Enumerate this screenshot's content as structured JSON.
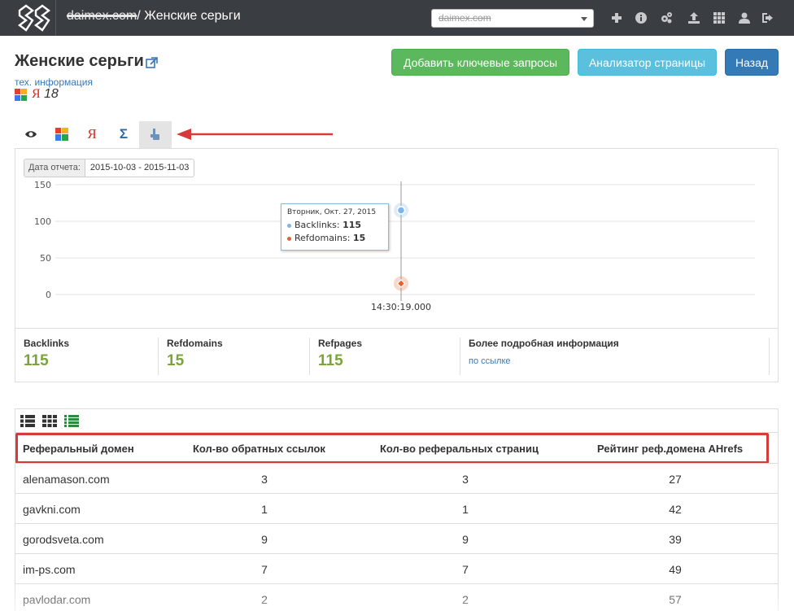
{
  "navbar": {
    "domain": "daimex.com",
    "separator": "/",
    "page": "Женские серьги",
    "site_select_value": "daimex.com",
    "icons": [
      "plus-icon",
      "info-icon",
      "cogs-icon",
      "upload-icon",
      "grid-icon",
      "user-icon",
      "logout-icon"
    ]
  },
  "header": {
    "title": "Женские серьги",
    "tech_link": "тех. информация",
    "yandex_letter": "Я",
    "position": "18"
  },
  "buttons": {
    "add_keywords": "Добавить ключевые запросы",
    "page_analyzer": "Анализатор страницы",
    "back": "Назад"
  },
  "tabs": {
    "yandex_letter": "Я",
    "sum_letter": "Σ",
    "active": "cursor-hand"
  },
  "report": {
    "date_label": "Дата отчета:",
    "date_range": "2015-10-03 - 2015-11-03"
  },
  "colors": {
    "backlinks": "#7cb5ec",
    "refdomains": "#e4632a",
    "stat_value": "#7aa33b",
    "highlight_box": "#d63a3a"
  },
  "chart_data": {
    "type": "scatter",
    "ylim": [
      0,
      150
    ],
    "y_ticks": [
      "0",
      "50",
      "100",
      "150"
    ],
    "x_ticks": [
      "14:30:19.000"
    ],
    "series": [
      {
        "name": "Backlinks",
        "values": [
          115
        ]
      },
      {
        "name": "Refdomains",
        "values": [
          15
        ]
      }
    ],
    "tooltip": {
      "title": "Вторник, Окт. 27, 2015",
      "rows": [
        {
          "name": "Backlinks",
          "value": "115"
        },
        {
          "name": "Refdomains",
          "value": "15"
        }
      ]
    }
  },
  "stats": {
    "backlinks_label": "Backlinks",
    "backlinks_value": "115",
    "refdomains_label": "Refdomains",
    "refdomains_value": "15",
    "refpages_label": "Refpages",
    "refpages_value": "115",
    "more_label": "Более подробная информация",
    "more_link": "по ссылке"
  },
  "table": {
    "columns": [
      "Реферальный домен",
      "Кол-во обратных ссылок",
      "Кол-во реферальных страниц",
      "Рейтинг реф.домена AHrefs"
    ],
    "rows": [
      [
        "alenamason.com",
        "3",
        "3",
        "27"
      ],
      [
        "gavkni.com",
        "1",
        "1",
        "42"
      ],
      [
        "gorodsveta.com",
        "9",
        "9",
        "39"
      ],
      [
        "im-ps.com",
        "7",
        "7",
        "49"
      ],
      [
        "pavlodar.com",
        "2",
        "2",
        "57"
      ]
    ]
  }
}
